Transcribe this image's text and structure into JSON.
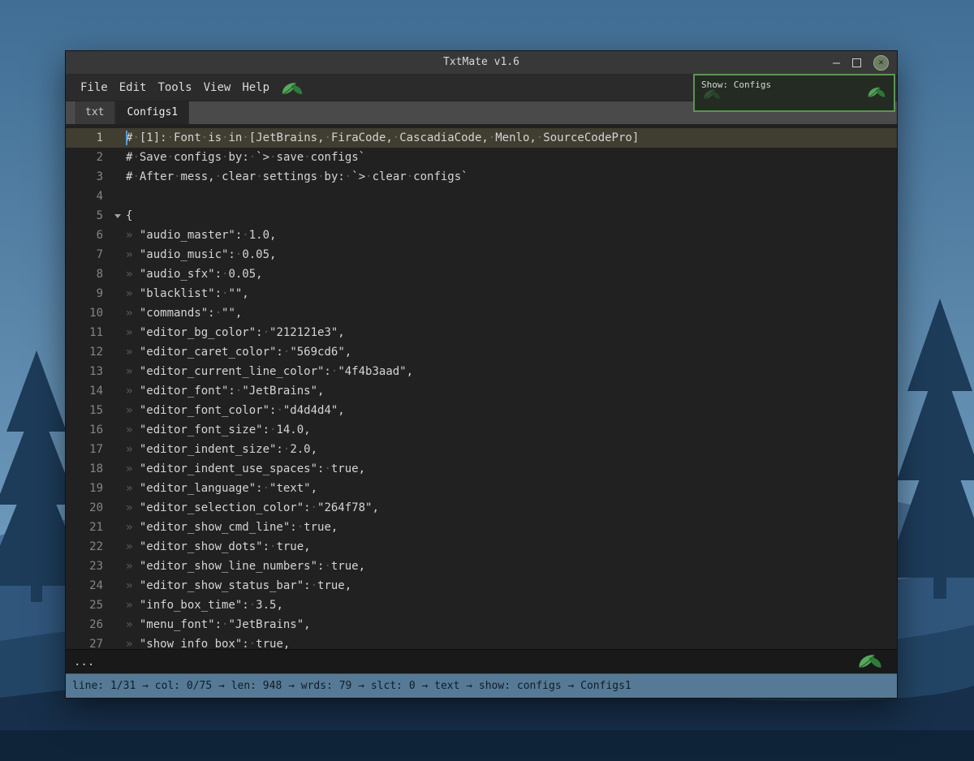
{
  "window": {
    "title": "TxtMate v1.6",
    "controls": {
      "minimize_glyph": "–",
      "close_glyph": "×"
    }
  },
  "menubar": {
    "items": [
      "File",
      "Edit",
      "Tools",
      "View",
      "Help"
    ]
  },
  "show_box": {
    "label": "Show: Configs",
    "border_color": "#5d9455"
  },
  "tabs": [
    {
      "label": "txt",
      "active": false
    },
    {
      "label": "Configs1",
      "active": true
    }
  ],
  "editor": {
    "current_line": 1,
    "caret": {
      "line": 1,
      "col": 0
    },
    "colors": {
      "bg": "#212121e3",
      "caret": "#569cd6",
      "current_line": "#4f4b3aad",
      "font": "#d4d4d4",
      "selection": "#264f78"
    },
    "lines": [
      {
        "n": 1,
        "text": "# [1]: Font is in [JetBrains, FiraCode, CascadiaCode, Menlo, SourceCodePro]"
      },
      {
        "n": 2,
        "text": "# Save configs by: `> save configs`"
      },
      {
        "n": 3,
        "text": "# After mess, clear settings by: `> clear configs`"
      },
      {
        "n": 4,
        "text": ""
      },
      {
        "n": 5,
        "text": "{",
        "fold": true
      },
      {
        "n": 6,
        "text": "  \"audio_master\": 1.0,"
      },
      {
        "n": 7,
        "text": "  \"audio_music\": 0.05,"
      },
      {
        "n": 8,
        "text": "  \"audio_sfx\": 0.05,"
      },
      {
        "n": 9,
        "text": "  \"blacklist\": \"\","
      },
      {
        "n": 10,
        "text": "  \"commands\": \"\","
      },
      {
        "n": 11,
        "text": "  \"editor_bg_color\": \"212121e3\","
      },
      {
        "n": 12,
        "text": "  \"editor_caret_color\": \"569cd6\","
      },
      {
        "n": 13,
        "text": "  \"editor_current_line_color\": \"4f4b3aad\","
      },
      {
        "n": 14,
        "text": "  \"editor_font\": \"JetBrains\","
      },
      {
        "n": 15,
        "text": "  \"editor_font_color\": \"d4d4d4\","
      },
      {
        "n": 16,
        "text": "  \"editor_font_size\": 14.0,"
      },
      {
        "n": 17,
        "text": "  \"editor_indent_size\": 2.0,"
      },
      {
        "n": 18,
        "text": "  \"editor_indent_use_spaces\": true,"
      },
      {
        "n": 19,
        "text": "  \"editor_language\": \"text\","
      },
      {
        "n": 20,
        "text": "  \"editor_selection_color\": \"264f78\","
      },
      {
        "n": 21,
        "text": "  \"editor_show_cmd_line\": true,"
      },
      {
        "n": 22,
        "text": "  \"editor_show_dots\": true,"
      },
      {
        "n": 23,
        "text": "  \"editor_show_line_numbers\": true,"
      },
      {
        "n": 24,
        "text": "  \"editor_show_status_bar\": true,"
      },
      {
        "n": 25,
        "text": "  \"info_box_time\": 3.5,"
      },
      {
        "n": 26,
        "text": "  \"menu_font\": \"JetBrains\","
      },
      {
        "n": 27,
        "text": "  \"show_info_box\": true,"
      }
    ]
  },
  "cmdline": {
    "text": "..."
  },
  "statusbar": {
    "text": "line: 1/31 → col: 0/75 → len: 948 → wrds: 79 → slct: 0 → text → show: configs → Configs1"
  }
}
